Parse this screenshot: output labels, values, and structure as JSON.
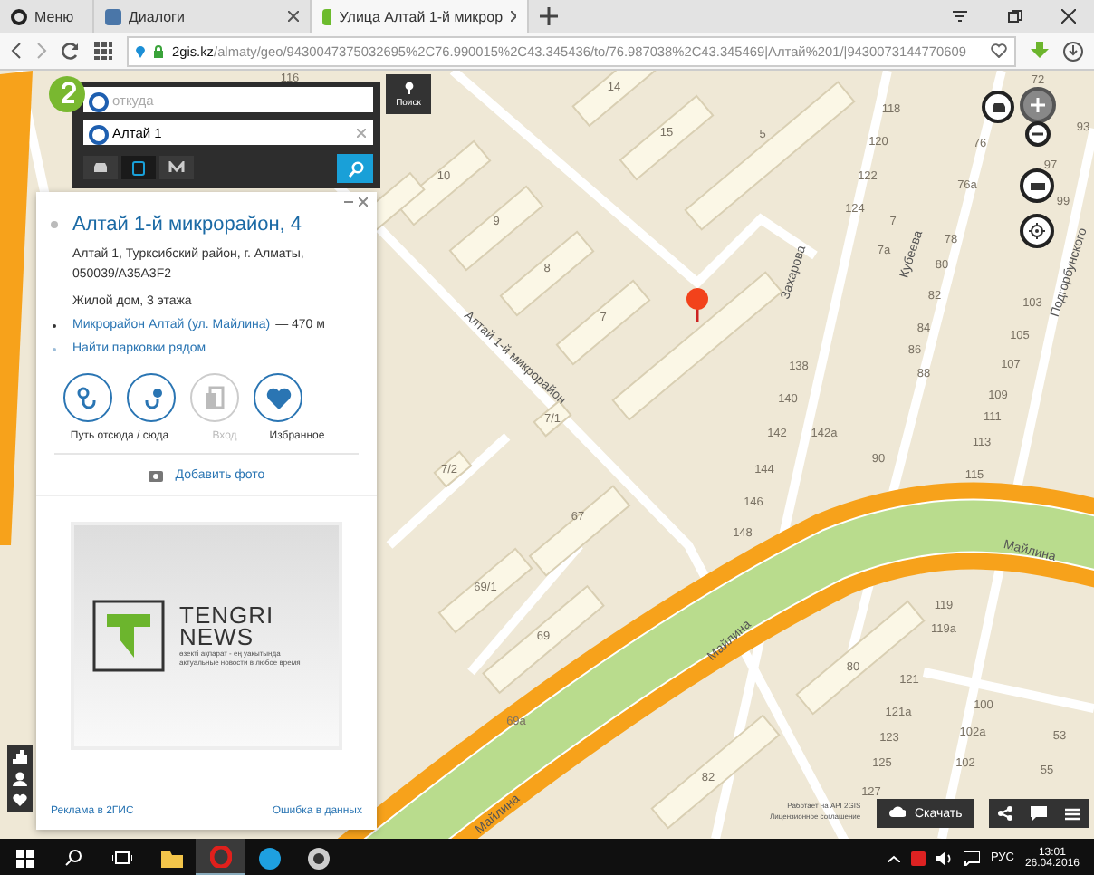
{
  "browser": {
    "tabs": [
      {
        "label": "Меню",
        "kind": "menu",
        "selected": false
      },
      {
        "label": "Диалоги",
        "kind": "page",
        "selected": false
      },
      {
        "label": "Улица Алтай 1-й микрор",
        "kind": "page",
        "selected": true
      }
    ],
    "url_host": "2gis.kz",
    "url_path": "/almaty/geo/9430047375032695%2C76.990015%2C43.345436/to/76.987038%2C43.345469|Алтай%201/|9430073144770609"
  },
  "route_search": {
    "from_placeholder": "откуда",
    "to_value": "Алтай 1",
    "side_button": "Поиск",
    "modes": [
      {
        "kind": "car",
        "selected": false
      },
      {
        "kind": "bus",
        "selected": true
      },
      {
        "kind": "metro",
        "selected": false
      }
    ]
  },
  "place_card": {
    "title": "Алтай 1-й микрорайон, 4",
    "address": "Алтай 1, Турксибский район, г. Алматы, 050039/A35A3F2",
    "description": "Жилой дом, 3 этажа",
    "stop_name": "Микрорайон Алтай (ул. Майлина)",
    "stop_distance": "— 470 м",
    "parking_link": "Найти парковки рядом",
    "route_label": "Путь отсюда / сюда",
    "actions": [
      {
        "kind": "route_from",
        "disabled": false
      },
      {
        "kind": "route_to",
        "disabled": false
      },
      {
        "kind": "entrance",
        "label": "Вход",
        "disabled": true
      },
      {
        "kind": "favorite",
        "label": "Избранное",
        "disabled": false
      }
    ],
    "add_photo": "Добавить фото",
    "ad": {
      "brand_line_1": "TENGRI",
      "brand_line_2": "NEWS",
      "tagline_1": "өзекті ақпарат - ең уақытында",
      "tagline_2": "актуальные новости в любое время"
    },
    "footer_links": [
      "Реклама в 2ГИС",
      "Ошибка в данных"
    ]
  },
  "map": {
    "labels": [
      {
        "text": "116",
        "kind": "house"
      },
      {
        "text": "72",
        "kind": "house"
      },
      {
        "text": "14",
        "kind": "house"
      },
      {
        "text": "15",
        "kind": "house"
      },
      {
        "text": "5",
        "kind": "house"
      },
      {
        "text": "10",
        "kind": "house"
      },
      {
        "text": "9",
        "kind": "house"
      },
      {
        "text": "8",
        "kind": "house"
      },
      {
        "text": "7",
        "kind": "house"
      },
      {
        "text": "7/1",
        "kind": "house"
      },
      {
        "text": "7/2",
        "kind": "house"
      },
      {
        "text": "118",
        "kind": "house"
      },
      {
        "text": "120",
        "kind": "house"
      },
      {
        "text": "122",
        "kind": "house"
      },
      {
        "text": "124",
        "kind": "house"
      },
      {
        "text": "7",
        "kind": "house"
      },
      {
        "text": "7а",
        "kind": "house"
      },
      {
        "text": "138",
        "kind": "house"
      },
      {
        "text": "140",
        "kind": "house"
      },
      {
        "text": "142",
        "kind": "house"
      },
      {
        "text": "142а",
        "kind": "house"
      },
      {
        "text": "144",
        "kind": "house"
      },
      {
        "text": "146",
        "kind": "house"
      },
      {
        "text": "148",
        "kind": "house"
      },
      {
        "text": "76",
        "kind": "house"
      },
      {
        "text": "76а",
        "kind": "house"
      },
      {
        "text": "78",
        "kind": "house"
      },
      {
        "text": "80",
        "kind": "house"
      },
      {
        "text": "82",
        "kind": "house"
      },
      {
        "text": "84",
        "kind": "house"
      },
      {
        "text": "86",
        "kind": "house"
      },
      {
        "text": "88",
        "kind": "house"
      },
      {
        "text": "90",
        "kind": "house"
      },
      {
        "text": "93",
        "kind": "house"
      },
      {
        "text": "97",
        "kind": "house"
      },
      {
        "text": "99",
        "kind": "house"
      },
      {
        "text": "103",
        "kind": "house"
      },
      {
        "text": "105",
        "kind": "house"
      },
      {
        "text": "107",
        "kind": "house"
      },
      {
        "text": "109",
        "kind": "house"
      },
      {
        "text": "111",
        "kind": "house"
      },
      {
        "text": "113",
        "kind": "house"
      },
      {
        "text": "115",
        "kind": "house"
      },
      {
        "text": "67",
        "kind": "house"
      },
      {
        "text": "69/1",
        "kind": "house"
      },
      {
        "text": "69",
        "kind": "house"
      },
      {
        "text": "69а",
        "kind": "house"
      },
      {
        "text": "80",
        "kind": "house"
      },
      {
        "text": "82",
        "kind": "house"
      },
      {
        "text": "119",
        "kind": "house"
      },
      {
        "text": "119а",
        "kind": "house"
      },
      {
        "text": "121",
        "kind": "house"
      },
      {
        "text": "121а",
        "kind": "house"
      },
      {
        "text": "123",
        "kind": "house"
      },
      {
        "text": "125",
        "kind": "house"
      },
      {
        "text": "127",
        "kind": "house"
      },
      {
        "text": "100",
        "kind": "house"
      },
      {
        "text": "102а",
        "kind": "house"
      },
      {
        "text": "102",
        "kind": "house"
      },
      {
        "text": "53",
        "kind": "house"
      },
      {
        "text": "55",
        "kind": "house"
      },
      {
        "text": "Алтай 1-й микрорайон",
        "kind": "street"
      },
      {
        "text": "Захарова",
        "kind": "street"
      },
      {
        "text": "Кубеева",
        "kind": "street"
      },
      {
        "text": "Подгорбунского",
        "kind": "street"
      },
      {
        "text": "Майлина",
        "kind": "street"
      },
      {
        "text": "Майлина",
        "kind": "street"
      },
      {
        "text": "Майлина",
        "kind": "street"
      }
    ],
    "attribution": [
      "Работает на API 2GIS",
      "Лицензионное соглашение"
    ],
    "download_button": "Скачать"
  },
  "taskbar": {
    "apps": [
      {
        "kind": "explorer",
        "selected": false
      },
      {
        "kind": "opera",
        "selected": true
      },
      {
        "kind": "skype",
        "selected": false
      },
      {
        "kind": "other",
        "selected": false
      }
    ],
    "language": "РУС",
    "time": "13:01",
    "date": "26.04.2016"
  }
}
